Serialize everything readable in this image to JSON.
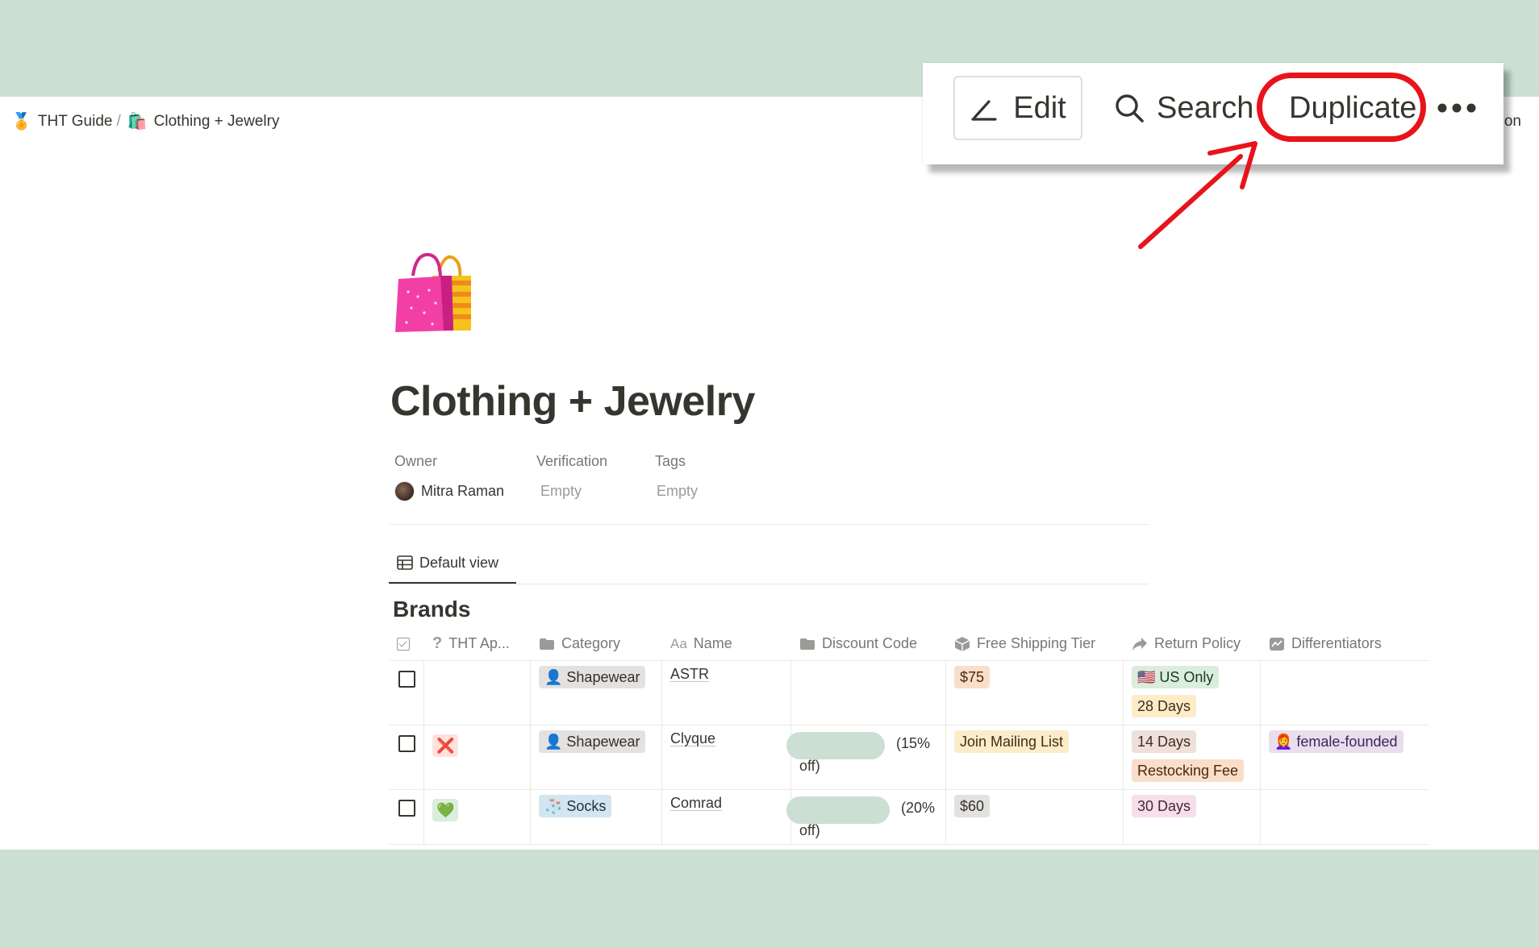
{
  "breadcrumb": {
    "items": [
      {
        "emoji": "🏅",
        "label": "THT Guide"
      },
      {
        "emoji": "🛍️",
        "label": "Clothing + Jewelry"
      }
    ],
    "separator": "/"
  },
  "topright_clipped_text": "ion",
  "page": {
    "icon": "shopping-bags-icon",
    "title": "Clothing + Jewelry"
  },
  "properties": [
    {
      "label": "Owner",
      "value": "Mitra Raman",
      "empty": false
    },
    {
      "label": "Verification",
      "value": "Empty",
      "empty": true
    },
    {
      "label": "Tags",
      "value": "Empty",
      "empty": true
    }
  ],
  "view": {
    "label": "Default view",
    "icon": "table-icon"
  },
  "database": {
    "title": "Brands",
    "columns": [
      {
        "key": "check",
        "label": "",
        "icon": "checkbox-icon"
      },
      {
        "key": "tht",
        "label": "THT Ap...",
        "icon": "question-icon"
      },
      {
        "key": "category",
        "label": "Category",
        "icon": "folder-icon"
      },
      {
        "key": "name",
        "label": "Name",
        "icon": "text-icon"
      },
      {
        "key": "discount",
        "label": "Discount Code",
        "icon": "folder-icon"
      },
      {
        "key": "shipping",
        "label": "Free Shipping Tier",
        "icon": "package-icon"
      },
      {
        "key": "return",
        "label": "Return Policy",
        "icon": "share-arrow-icon"
      },
      {
        "key": "diff",
        "label": "Differentiators",
        "icon": "chart-icon"
      }
    ],
    "text_icon_glyph": "Aa",
    "rows": [
      {
        "tht": "",
        "category": "👤 Shapewear",
        "name": "ASTR",
        "discount": "",
        "shipping": "$75",
        "return": [
          "🇺🇸 US Only",
          "28 Days"
        ],
        "diff": ""
      },
      {
        "tht": "❌",
        "category": "👤 Shapewear",
        "name": "Clyque",
        "discount": "(15% off)",
        "shipping": "Join Mailing List",
        "return": [
          "14 Days",
          "Restocking Fee"
        ],
        "diff": "👩‍🦰 female-founded"
      },
      {
        "tht": "💚",
        "category": "🧦 Socks",
        "name": "Comrad",
        "discount": "(20% off)",
        "shipping": "$60",
        "return": [
          "30 Days"
        ],
        "diff": ""
      }
    ]
  },
  "toolbar": {
    "edit_label": "Edit",
    "search_label": "Search",
    "duplicate_label": "Duplicate",
    "more_icon": "more-dots-icon"
  },
  "colors": {
    "background": "#cbdfd3",
    "highlight": "#e8131b",
    "text": "#37352f"
  }
}
